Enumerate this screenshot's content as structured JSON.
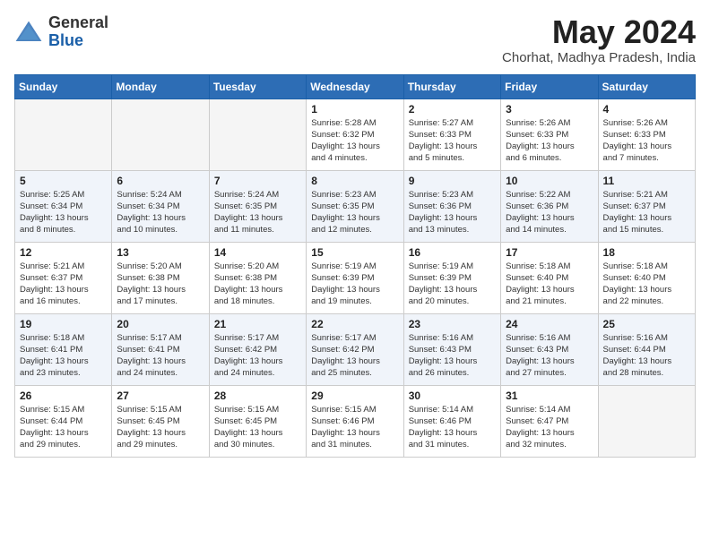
{
  "header": {
    "logo_line1": "General",
    "logo_line2": "Blue",
    "month_year": "May 2024",
    "location": "Chorhat, Madhya Pradesh, India"
  },
  "weekdays": [
    "Sunday",
    "Monday",
    "Tuesday",
    "Wednesday",
    "Thursday",
    "Friday",
    "Saturday"
  ],
  "weeks": [
    [
      {
        "day": "",
        "info": ""
      },
      {
        "day": "",
        "info": ""
      },
      {
        "day": "",
        "info": ""
      },
      {
        "day": "1",
        "info": "Sunrise: 5:28 AM\nSunset: 6:32 PM\nDaylight: 13 hours\nand 4 minutes."
      },
      {
        "day": "2",
        "info": "Sunrise: 5:27 AM\nSunset: 6:33 PM\nDaylight: 13 hours\nand 5 minutes."
      },
      {
        "day": "3",
        "info": "Sunrise: 5:26 AM\nSunset: 6:33 PM\nDaylight: 13 hours\nand 6 minutes."
      },
      {
        "day": "4",
        "info": "Sunrise: 5:26 AM\nSunset: 6:33 PM\nDaylight: 13 hours\nand 7 minutes."
      }
    ],
    [
      {
        "day": "5",
        "info": "Sunrise: 5:25 AM\nSunset: 6:34 PM\nDaylight: 13 hours\nand 8 minutes."
      },
      {
        "day": "6",
        "info": "Sunrise: 5:24 AM\nSunset: 6:34 PM\nDaylight: 13 hours\nand 10 minutes."
      },
      {
        "day": "7",
        "info": "Sunrise: 5:24 AM\nSunset: 6:35 PM\nDaylight: 13 hours\nand 11 minutes."
      },
      {
        "day": "8",
        "info": "Sunrise: 5:23 AM\nSunset: 6:35 PM\nDaylight: 13 hours\nand 12 minutes."
      },
      {
        "day": "9",
        "info": "Sunrise: 5:23 AM\nSunset: 6:36 PM\nDaylight: 13 hours\nand 13 minutes."
      },
      {
        "day": "10",
        "info": "Sunrise: 5:22 AM\nSunset: 6:36 PM\nDaylight: 13 hours\nand 14 minutes."
      },
      {
        "day": "11",
        "info": "Sunrise: 5:21 AM\nSunset: 6:37 PM\nDaylight: 13 hours\nand 15 minutes."
      }
    ],
    [
      {
        "day": "12",
        "info": "Sunrise: 5:21 AM\nSunset: 6:37 PM\nDaylight: 13 hours\nand 16 minutes."
      },
      {
        "day": "13",
        "info": "Sunrise: 5:20 AM\nSunset: 6:38 PM\nDaylight: 13 hours\nand 17 minutes."
      },
      {
        "day": "14",
        "info": "Sunrise: 5:20 AM\nSunset: 6:38 PM\nDaylight: 13 hours\nand 18 minutes."
      },
      {
        "day": "15",
        "info": "Sunrise: 5:19 AM\nSunset: 6:39 PM\nDaylight: 13 hours\nand 19 minutes."
      },
      {
        "day": "16",
        "info": "Sunrise: 5:19 AM\nSunset: 6:39 PM\nDaylight: 13 hours\nand 20 minutes."
      },
      {
        "day": "17",
        "info": "Sunrise: 5:18 AM\nSunset: 6:40 PM\nDaylight: 13 hours\nand 21 minutes."
      },
      {
        "day": "18",
        "info": "Sunrise: 5:18 AM\nSunset: 6:40 PM\nDaylight: 13 hours\nand 22 minutes."
      }
    ],
    [
      {
        "day": "19",
        "info": "Sunrise: 5:18 AM\nSunset: 6:41 PM\nDaylight: 13 hours\nand 23 minutes."
      },
      {
        "day": "20",
        "info": "Sunrise: 5:17 AM\nSunset: 6:41 PM\nDaylight: 13 hours\nand 24 minutes."
      },
      {
        "day": "21",
        "info": "Sunrise: 5:17 AM\nSunset: 6:42 PM\nDaylight: 13 hours\nand 24 minutes."
      },
      {
        "day": "22",
        "info": "Sunrise: 5:17 AM\nSunset: 6:42 PM\nDaylight: 13 hours\nand 25 minutes."
      },
      {
        "day": "23",
        "info": "Sunrise: 5:16 AM\nSunset: 6:43 PM\nDaylight: 13 hours\nand 26 minutes."
      },
      {
        "day": "24",
        "info": "Sunrise: 5:16 AM\nSunset: 6:43 PM\nDaylight: 13 hours\nand 27 minutes."
      },
      {
        "day": "25",
        "info": "Sunrise: 5:16 AM\nSunset: 6:44 PM\nDaylight: 13 hours\nand 28 minutes."
      }
    ],
    [
      {
        "day": "26",
        "info": "Sunrise: 5:15 AM\nSunset: 6:44 PM\nDaylight: 13 hours\nand 29 minutes."
      },
      {
        "day": "27",
        "info": "Sunrise: 5:15 AM\nSunset: 6:45 PM\nDaylight: 13 hours\nand 29 minutes."
      },
      {
        "day": "28",
        "info": "Sunrise: 5:15 AM\nSunset: 6:45 PM\nDaylight: 13 hours\nand 30 minutes."
      },
      {
        "day": "29",
        "info": "Sunrise: 5:15 AM\nSunset: 6:46 PM\nDaylight: 13 hours\nand 31 minutes."
      },
      {
        "day": "30",
        "info": "Sunrise: 5:14 AM\nSunset: 6:46 PM\nDaylight: 13 hours\nand 31 minutes."
      },
      {
        "day": "31",
        "info": "Sunrise: 5:14 AM\nSunset: 6:47 PM\nDaylight: 13 hours\nand 32 minutes."
      },
      {
        "day": "",
        "info": ""
      }
    ]
  ]
}
